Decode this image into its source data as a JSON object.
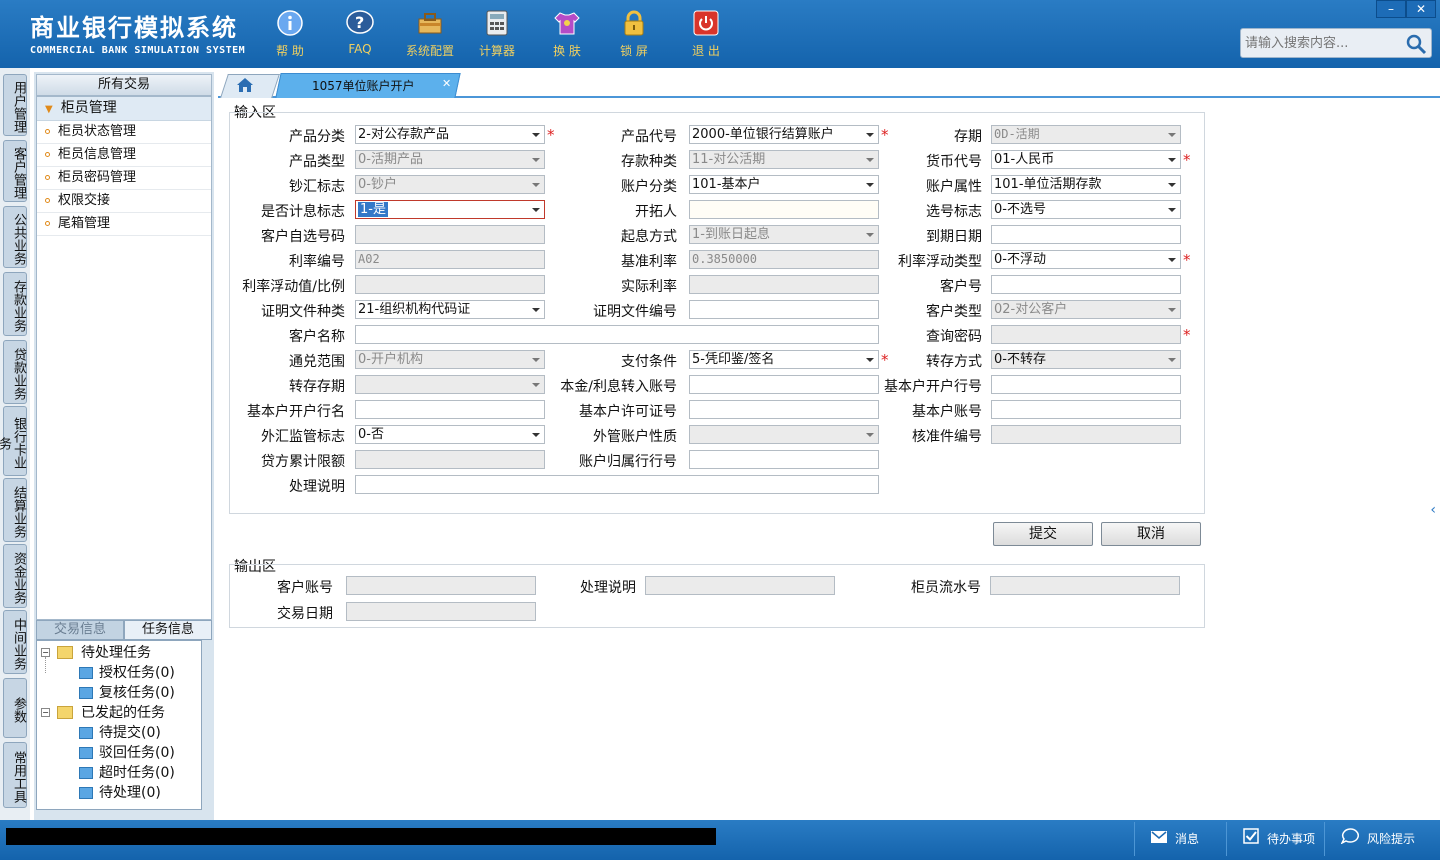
{
  "app": {
    "title_cn": "商业银行模拟系统",
    "title_en": "COMMERCIAL BANK SIMULATION SYSTEM"
  },
  "toolbar": [
    {
      "label": "帮 助",
      "icon": "info-icon"
    },
    {
      "label": "FAQ",
      "icon": "question-icon"
    },
    {
      "label": "系统配置",
      "icon": "toolbox-icon"
    },
    {
      "label": "计算器",
      "icon": "calculator-icon"
    },
    {
      "label": "换 肤",
      "icon": "shirt-icon"
    },
    {
      "label": "锁 屏",
      "icon": "lock-icon"
    },
    {
      "label": "退 出",
      "icon": "power-icon"
    }
  ],
  "window": {
    "minimize": "–",
    "close": "✕"
  },
  "search": {
    "placeholder": "请输入搜索内容..."
  },
  "vtabs": [
    "用户管理",
    "客户管理",
    "公共业务",
    "存款业务",
    "贷款业务",
    "银行卡业务",
    "结算业务",
    "资金业务",
    "中间业务",
    "参数",
    "常用工具"
  ],
  "tree": {
    "header": "所有交易",
    "group": "柜员管理",
    "items": [
      "柜员状态管理",
      "柜员信息管理",
      "柜员密码管理",
      "权限交接",
      "尾箱管理"
    ]
  },
  "info_tabs": {
    "inactive": "交易信息",
    "active": "任务信息"
  },
  "tasks": {
    "pending": "待处理任务",
    "auth": "授权任务(0)",
    "review": "复核任务(0)",
    "initiated": "已发起的任务",
    "to_submit": "待提交(0)",
    "rejected": "驳回任务(0)",
    "timeout": "超时任务(0)",
    "to_process": "待处理(0)"
  },
  "tabs": {
    "active": "1057单位账户开户"
  },
  "input_section": "输入区",
  "output_section": "输出区",
  "form": {
    "product_cat": {
      "label": "产品分类",
      "value": "2-对公存款产品"
    },
    "product_code": {
      "label": "产品代号",
      "value": "2000-单位银行结算账户"
    },
    "term": {
      "label": "存期",
      "value": "0D-活期"
    },
    "product_type": {
      "label": "产品类型",
      "value": "0-活期产品"
    },
    "deposit_kind": {
      "label": "存款种类",
      "value": "11-对公活期"
    },
    "currency": {
      "label": "货币代号",
      "value": "01-人民币"
    },
    "cash_flag": {
      "label": "钞汇标志",
      "value": "0-钞户"
    },
    "account_cat": {
      "label": "账户分类",
      "value": "101-基本户"
    },
    "account_attr": {
      "label": "账户属性",
      "value": "101-单位活期存款"
    },
    "interest_flag": {
      "label": "是否计息标志",
      "value": "1-是"
    },
    "developer": {
      "label": "开拓人",
      "value": ""
    },
    "choose_no_flag": {
      "label": "选号标志",
      "value": "0-不选号"
    },
    "self_choose_no": {
      "label": "客户自选号码",
      "value": ""
    },
    "interest_start": {
      "label": "起息方式",
      "value": "1-到账日起息"
    },
    "due_date": {
      "label": "到期日期",
      "value": ""
    },
    "rate_no": {
      "label": "利率编号",
      "value": "A02"
    },
    "base_rate": {
      "label": "基准利率",
      "value": "0.3850000"
    },
    "float_type": {
      "label": "利率浮动类型",
      "value": "0-不浮动"
    },
    "float_value": {
      "label": "利率浮动值/比例",
      "value": ""
    },
    "actual_rate": {
      "label": "实际利率",
      "value": ""
    },
    "customer_no": {
      "label": "客户号",
      "value": ""
    },
    "cert_type": {
      "label": "证明文件种类",
      "value": "21-组织机构代码证"
    },
    "cert_no": {
      "label": "证明文件编号",
      "value": ""
    },
    "customer_type": {
      "label": "客户类型",
      "value": "02-对公客户"
    },
    "customer_name": {
      "label": "客户名称",
      "value": ""
    },
    "query_pwd": {
      "label": "查询密码",
      "value": ""
    },
    "exchange_range": {
      "label": "通兑范围",
      "value": "0-开户机构"
    },
    "pay_cond": {
      "label": "支付条件",
      "value": "5-凭印鉴/签名"
    },
    "transfer_mode": {
      "label": "转存方式",
      "value": "0-不转存"
    },
    "transfer_term": {
      "label": "转存存期",
      "value": ""
    },
    "principal_account": {
      "label": "本金/利息转入账号",
      "value": ""
    },
    "basic_bank_no": {
      "label": "基本户开户行号",
      "value": ""
    },
    "basic_bank_name": {
      "label": "基本户开户行名",
      "value": ""
    },
    "basic_license": {
      "label": "基本户许可证号",
      "value": ""
    },
    "basic_account": {
      "label": "基本户账号",
      "value": ""
    },
    "fx_flag": {
      "label": "外汇监管标志",
      "value": "0-否"
    },
    "fx_nature": {
      "label": "外管账户性质",
      "value": ""
    },
    "approval_no": {
      "label": "核准件编号",
      "value": ""
    },
    "credit_limit": {
      "label": "贷方累计限额",
      "value": ""
    },
    "branch_no": {
      "label": "账户归属行行号",
      "value": ""
    },
    "remark": {
      "label": "处理说明",
      "value": ""
    }
  },
  "buttons": {
    "submit": "提交",
    "cancel": "取消"
  },
  "output": {
    "account": {
      "label": "客户账号",
      "value": ""
    },
    "remark": {
      "label": "处理说明",
      "value": ""
    },
    "serial": {
      "label": "柜员流水号",
      "value": ""
    },
    "date": {
      "label": "交易日期",
      "value": ""
    }
  },
  "statusbar": {
    "message": "消息",
    "todo": "待办事项",
    "risk": "风险提示"
  },
  "required_mark": "*"
}
